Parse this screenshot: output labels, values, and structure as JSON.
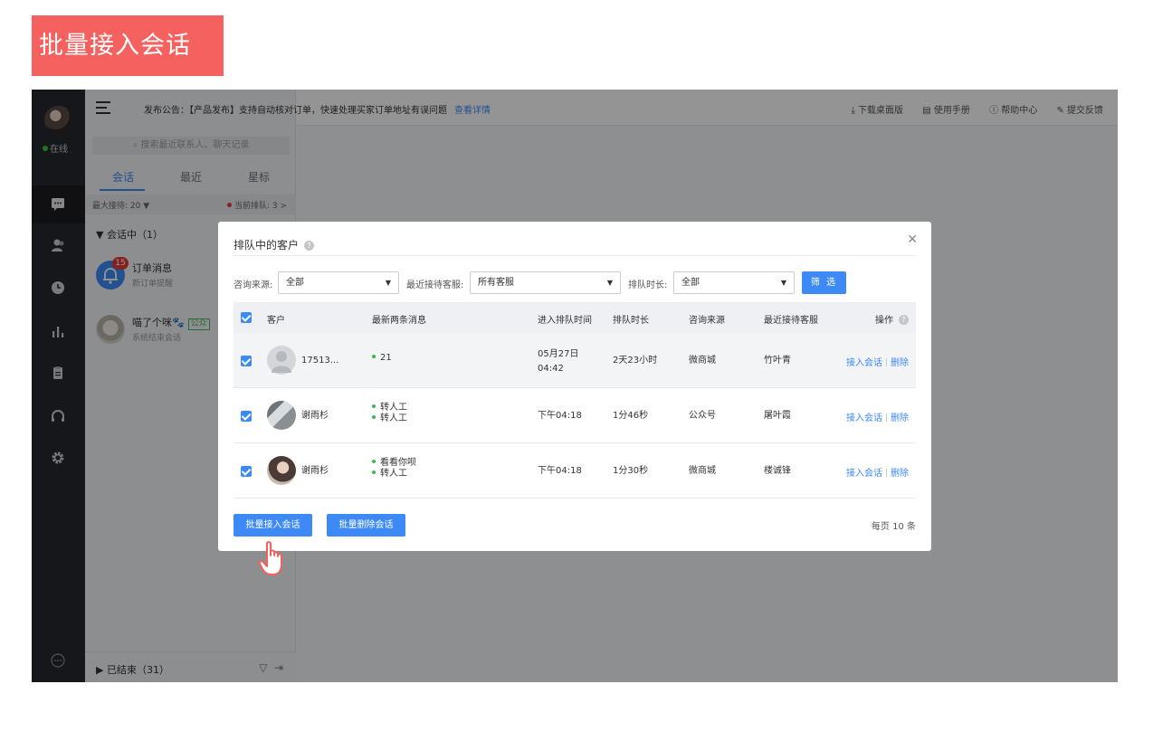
{
  "banner": {
    "title": "批量接入会话"
  },
  "rail": {
    "status": "在线",
    "icons": [
      "chat-icon",
      "contacts-icon",
      "history-icon",
      "stats-icon",
      "clipboard-icon",
      "headset-icon",
      "settings-icon",
      "more-icon"
    ]
  },
  "sidebar": {
    "search_placeholder": "搜索最近联系人、聊天记录",
    "tabs": [
      {
        "label": "会话",
        "active": true
      },
      {
        "label": "最近",
        "active": false
      },
      {
        "label": "星标",
        "active": false
      }
    ],
    "max_reception": "最大接待: 20 ▼",
    "queue_count": "当前排队: 3 >",
    "group_label": "▼ 会话中（1）",
    "conversations": [
      {
        "name": "订单消息",
        "sub": "新订单提醒",
        "badge": "15"
      },
      {
        "name": "喵了个咪🐾",
        "sub": "系统结束会话",
        "tag": "公众"
      }
    ],
    "ended_label": "▶ 已结束（31）"
  },
  "topbar": {
    "notice": "发布公告：【产品发布】支持自动核对订单，快速处理买家订单地址有误问题",
    "notice_link": "查看详情",
    "actions": [
      "⤓ 下载桌面版",
      "▤ 使用手册",
      "ⓘ 帮助中心",
      "✎ 提交反馈"
    ]
  },
  "modal": {
    "title": "排队中的客户",
    "filters": {
      "source_label": "咨询来源:",
      "source_value": "全部",
      "agent_label": "最近接待客服:",
      "agent_value": "所有客服",
      "duration_label": "排队时长:",
      "duration_value": "全部",
      "button": "筛 选"
    },
    "columns": [
      "客户",
      "最新两条消息",
      "进入排队时间",
      "排队时长",
      "咨询来源",
      "最近接待客服",
      "操作"
    ],
    "rows": [
      {
        "customer": "17513...",
        "messages": [
          "21"
        ],
        "time_line1": "05月27日",
        "time_line2": "04:42",
        "duration": "2天23小时",
        "source": "微商城",
        "agent": "竹叶青"
      },
      {
        "customer": "谢雨杉",
        "messages": [
          "转人工",
          "转人工"
        ],
        "time_line1": "下午04:18",
        "time_line2": "",
        "duration": "1分46秒",
        "source": "公众号",
        "agent": "屠叶霞"
      },
      {
        "customer": "谢雨杉",
        "messages": [
          "看看你呗",
          "转人工"
        ],
        "time_line1": "下午04:18",
        "time_line2": "",
        "duration": "1分30秒",
        "source": "微商城",
        "agent": "楼诚锋"
      }
    ],
    "op_accept": "接入会话",
    "op_delete": "删除",
    "batch_accept": "批量接入会话",
    "batch_delete": "批量删除会话",
    "per_page": "每页 10 条"
  },
  "colors": {
    "accent": "#3d8af7",
    "banner": "#f4615f",
    "rail": "#27292f"
  }
}
